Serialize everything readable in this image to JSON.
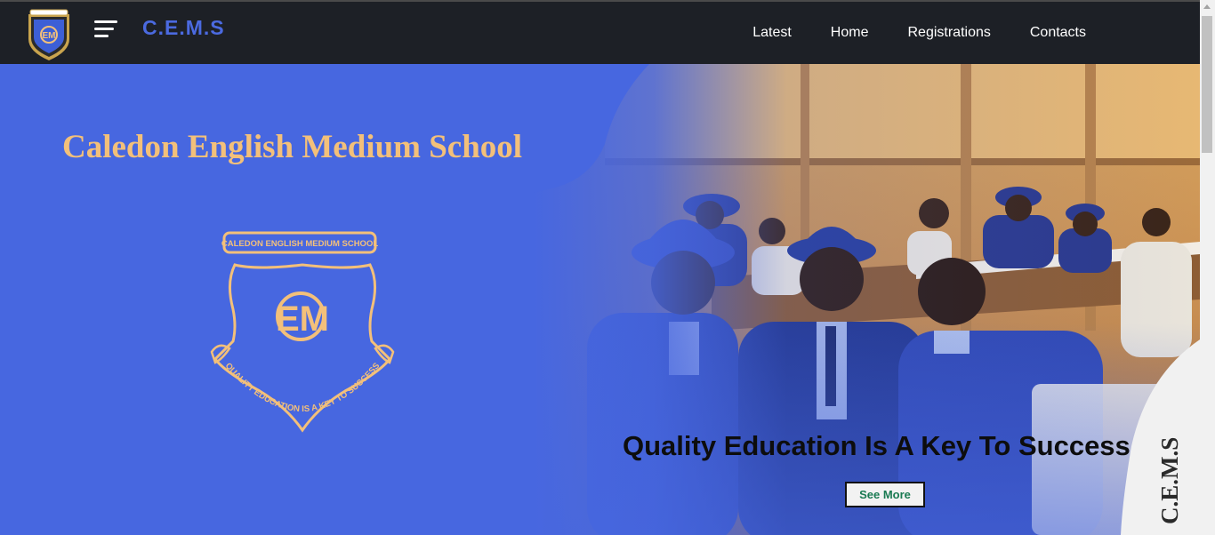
{
  "navbar": {
    "brand": "C.E.M.S",
    "logo_icon": "school-crest-icon",
    "menu_icon": "hamburger-menu-icon",
    "links": [
      {
        "label": "Latest"
      },
      {
        "label": "Home"
      },
      {
        "label": "Registrations"
      },
      {
        "label": "Contacts"
      }
    ]
  },
  "hero": {
    "title": "Caledon English Medium School",
    "crest": {
      "banner_text": "CALEDON ENGLISH MEDIUM SCHOOL",
      "monogram": "EM",
      "motto": "QUALITY EDUCATION IS A KEY TO SUCCESS"
    },
    "tagline": "Quality Education Is A Key To Success",
    "cta_label": "See More",
    "side_mark": "C.E.M.S"
  },
  "colors": {
    "navbar_bg": "#1d2026",
    "brand_blue": "#4b6ae0",
    "hero_blue": "#4767e0",
    "gold": "#f3c07a",
    "cta_text": "#1a7a52"
  }
}
